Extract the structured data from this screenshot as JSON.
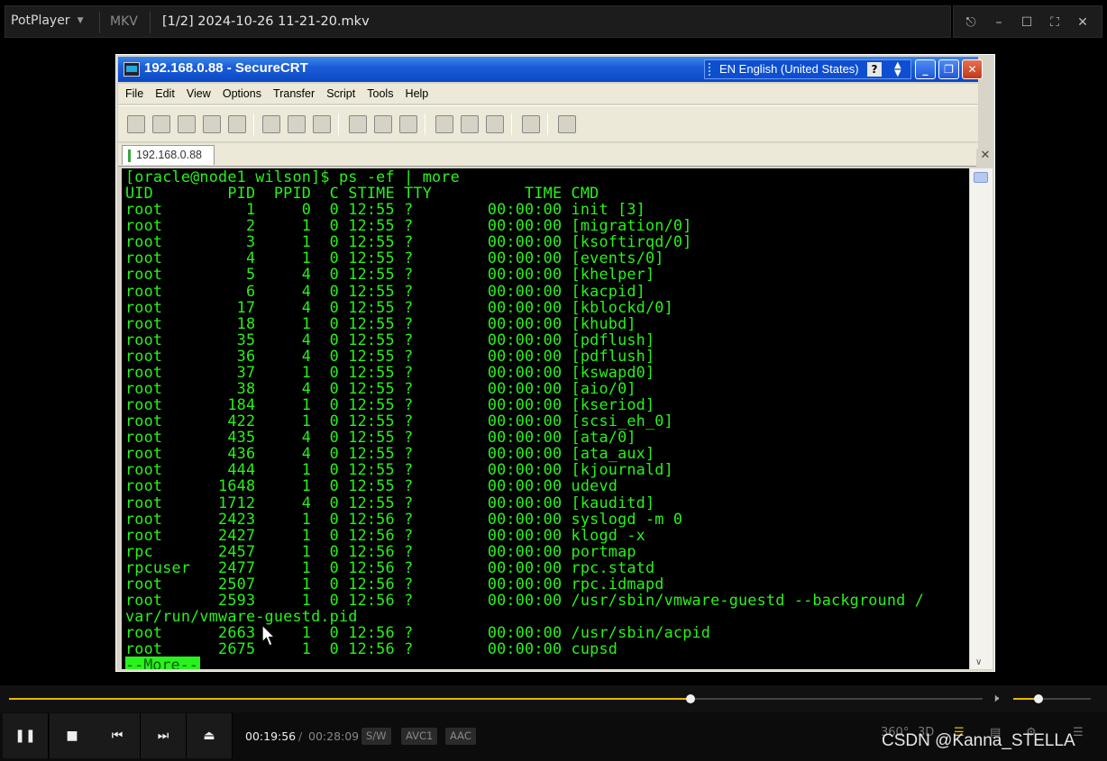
{
  "player": {
    "app_name": "PotPlayer",
    "format": "MKV",
    "file_title": "[1/2] 2024-10-26 11-21-20.mkv",
    "window_buttons": [
      "pin-icon",
      "minimize-icon",
      "maximize-icon",
      "fullscreen-icon",
      "close-icon"
    ]
  },
  "securecrt": {
    "title": "192.168.0.88 - SecureCRT",
    "language": "EN English (United States)",
    "help_glyph": "?",
    "menu": [
      "File",
      "Edit",
      "View",
      "Options",
      "Transfer",
      "Script",
      "Tools",
      "Help"
    ],
    "session_tab": "192.168.0.88",
    "terminal_lines": [
      "[oracle@node1 wilson]$ ps -ef | more",
      "UID        PID  PPID  C STIME TTY          TIME CMD",
      "root         1     0  0 12:55 ?        00:00:00 init [3]",
      "root         2     1  0 12:55 ?        00:00:00 [migration/0]",
      "root         3     1  0 12:55 ?        00:00:00 [ksoftirqd/0]",
      "root         4     1  0 12:55 ?        00:00:00 [events/0]",
      "root         5     4  0 12:55 ?        00:00:00 [khelper]",
      "root         6     4  0 12:55 ?        00:00:00 [kacpid]",
      "root        17     4  0 12:55 ?        00:00:00 [kblockd/0]",
      "root        18     1  0 12:55 ?        00:00:00 [khubd]",
      "root        35     4  0 12:55 ?        00:00:00 [pdflush]",
      "root        36     4  0 12:55 ?        00:00:00 [pdflush]",
      "root        37     1  0 12:55 ?        00:00:00 [kswapd0]",
      "root        38     4  0 12:55 ?        00:00:00 [aio/0]",
      "root       184     1  0 12:55 ?        00:00:00 [kseriod]",
      "root       422     1  0 12:55 ?        00:00:00 [scsi_eh_0]",
      "root       435     4  0 12:55 ?        00:00:00 [ata/0]",
      "root       436     4  0 12:55 ?        00:00:00 [ata_aux]",
      "root       444     1  0 12:55 ?        00:00:00 [kjournald]",
      "root      1648     1  0 12:55 ?        00:00:00 udevd",
      "root      1712     4  0 12:55 ?        00:00:00 [kauditd]",
      "root      2423     1  0 12:56 ?        00:00:00 syslogd -m 0",
      "root      2427     1  0 12:56 ?        00:00:00 klogd -x",
      "rpc       2457     1  0 12:56 ?        00:00:00 portmap",
      "rpcuser   2477     1  0 12:56 ?        00:00:00 rpc.statd",
      "root      2507     1  0 12:56 ?        00:00:00 rpc.idmapd",
      "root      2593     1  0 12:56 ?        00:00:00 /usr/sbin/vmware-guestd --background /",
      "var/run/vmware-guestd.pid",
      "root      2663     1  0 12:56 ?        00:00:00 /usr/sbin/acpid",
      "root      2675     1  0 12:56 ?        00:00:00 cupsd"
    ],
    "more_prompt": "--More--"
  },
  "playback": {
    "progress": 0.7,
    "volume": 0.32,
    "current_time": "00:19:56",
    "time_separator": "/",
    "total_time": "00:28:09",
    "badges": [
      "S/W",
      "AVC1",
      "AAC"
    ],
    "right_controls": [
      "360°",
      "3D"
    ],
    "accent_color": "#e8b800"
  },
  "watermark": "CSDN @Kanna_STELLA"
}
